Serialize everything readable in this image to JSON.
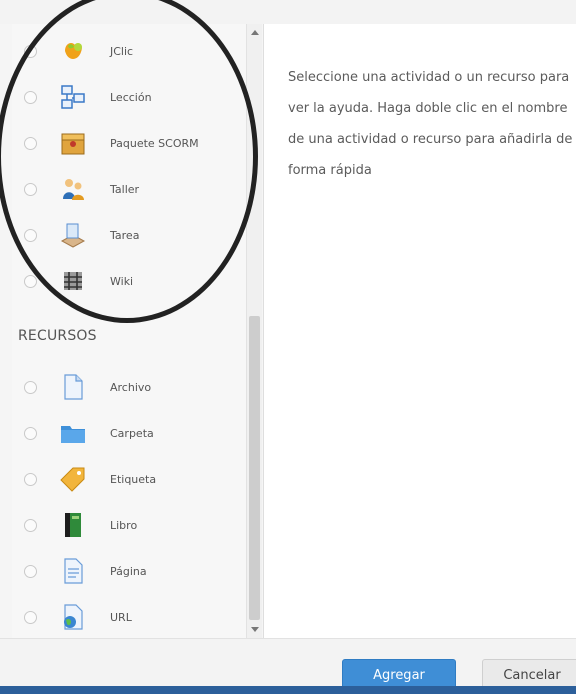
{
  "activities": [
    {
      "label": "JClic",
      "icon": "jclic-icon"
    },
    {
      "label": "Lección",
      "icon": "lesson-icon"
    },
    {
      "label": "Paquete SCORM",
      "icon": "scorm-package-icon"
    },
    {
      "label": "Taller",
      "icon": "workshop-icon"
    },
    {
      "label": "Tarea",
      "icon": "assignment-icon"
    },
    {
      "label": "Wiki",
      "icon": "wiki-icon"
    }
  ],
  "resources_section_title": "RECURSOS",
  "resources": [
    {
      "label": "Archivo",
      "icon": "file-icon"
    },
    {
      "label": "Carpeta",
      "icon": "folder-icon"
    },
    {
      "label": "Etiqueta",
      "icon": "label-tag-icon"
    },
    {
      "label": "Libro",
      "icon": "book-icon"
    },
    {
      "label": "Página",
      "icon": "page-icon"
    },
    {
      "label": "URL",
      "icon": "url-icon"
    }
  ],
  "help_text": "Seleccione una actividad o un recurso para ver la ayuda. Haga doble clic en el nombre de una actividad o recurso para añadirla de forma rápida",
  "buttons": {
    "add_label": "Agregar",
    "cancel_label": "Cancelar"
  },
  "colors": {
    "primary_button": "#3f8ed6",
    "annotation_circle": "#222222"
  }
}
